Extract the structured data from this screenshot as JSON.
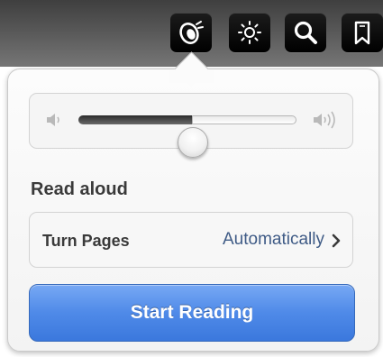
{
  "toolbar": {
    "buttons": [
      {
        "icon": "speaker-aloud-icon"
      },
      {
        "icon": "brightness-icon"
      },
      {
        "icon": "search-icon"
      },
      {
        "icon": "bookmark-icon"
      }
    ]
  },
  "volume": {
    "level": 0.52,
    "min_icon": "speaker-low-icon",
    "max_icon": "speaker-high-icon"
  },
  "read_aloud": {
    "title": "Read aloud",
    "turn_pages_label": "Turn Pages",
    "turn_pages_value": "Automatically"
  },
  "start_button": {
    "label": "Start Reading",
    "color": "#4f8ae8"
  }
}
